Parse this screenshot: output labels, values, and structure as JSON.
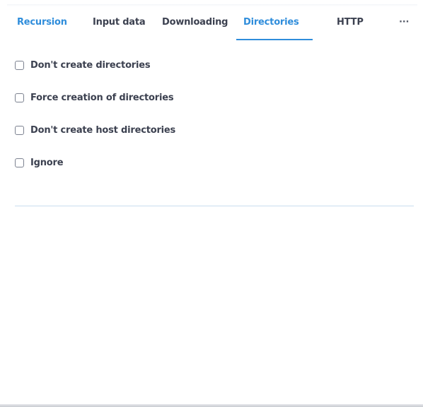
{
  "tabs": [
    {
      "label": "Recursion",
      "state": "highlighted"
    },
    {
      "label": "Input data"
    },
    {
      "label": "Downloading"
    },
    {
      "label": "Directories",
      "state": "selected"
    },
    {
      "label": "HTTP"
    }
  ],
  "more_tabs_label": "···",
  "colors": {
    "accent": "#2f8ddb",
    "text": "#3c4150",
    "divider": "#c8ddef"
  },
  "options": [
    {
      "label": "Don't create directories",
      "checked": false
    },
    {
      "label": "Force creation of directories",
      "checked": false
    },
    {
      "label": "Don't create host directories",
      "checked": false
    },
    {
      "label": "Ignore",
      "checked": false
    }
  ]
}
